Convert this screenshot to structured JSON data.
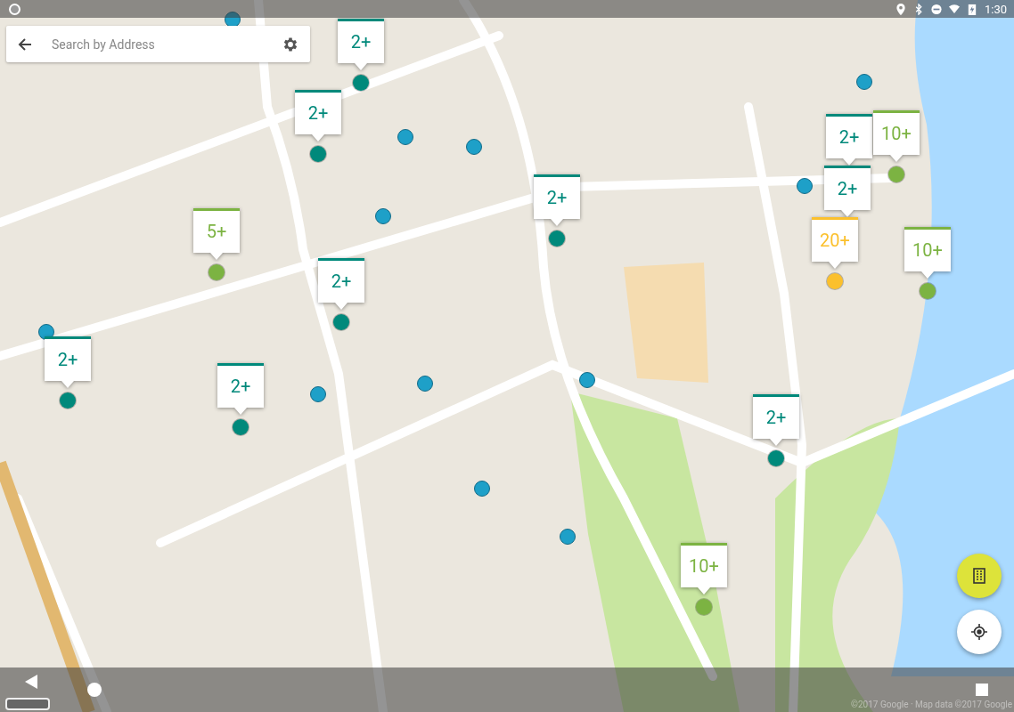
{
  "status_bar": {
    "time": "1:30"
  },
  "search": {
    "placeholder": "Search by Address"
  },
  "clusters": [
    {
      "label": "2+",
      "color": "#00897b"
    },
    {
      "label": "2+",
      "color": "#00897b"
    },
    {
      "label": "5+",
      "color": "#7cb342"
    },
    {
      "label": "2+",
      "color": "#00897b"
    },
    {
      "label": "2+",
      "color": "#00897b"
    },
    {
      "label": "2+",
      "color": "#00897b"
    },
    {
      "label": "2+",
      "color": "#00897b"
    },
    {
      "label": "2+",
      "color": "#00897b"
    },
    {
      "label": "10+",
      "color": "#7cb342"
    },
    {
      "label": "2+",
      "color": "#00897b"
    },
    {
      "label": "20+",
      "color": "#fbc02d"
    },
    {
      "label": "10+",
      "color": "#7cb342"
    },
    {
      "label": "2+",
      "color": "#00897b"
    },
    {
      "label": "10+",
      "color": "#7cb342"
    }
  ],
  "map_attribution": "©2017 Google · Map data ©2017 Google"
}
